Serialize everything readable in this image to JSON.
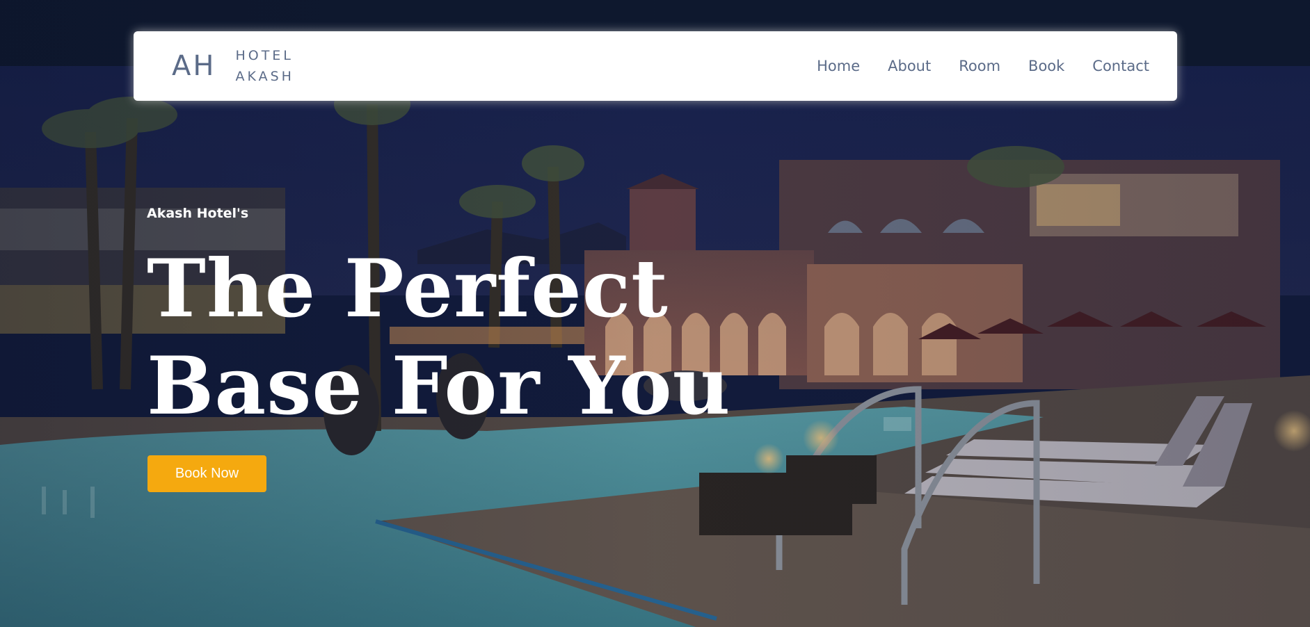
{
  "brand": {
    "mark": "AH",
    "name_line1": "HOTEL",
    "name_line2": "AKASH"
  },
  "nav": {
    "items": [
      {
        "label": "Home"
      },
      {
        "label": "About"
      },
      {
        "label": "Room"
      },
      {
        "label": "Book"
      },
      {
        "label": "Contact"
      }
    ]
  },
  "hero": {
    "eyebrow": "Akash Hotel's",
    "headline_line1": "The Perfect",
    "headline_line2": "Base For You",
    "cta_label": "Book Now"
  },
  "colors": {
    "accent": "#f5a90f",
    "nav_text": "#5b6b88",
    "navbar_bg": "#ffffff",
    "hero_text": "#ffffff"
  }
}
